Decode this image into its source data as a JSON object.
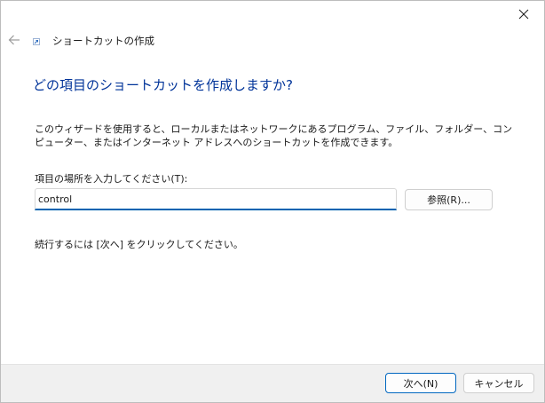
{
  "window": {
    "close_glyph": "✕"
  },
  "wizard": {
    "title": "ショートカットの作成",
    "heading": "どの項目のショートカットを作成しますか?",
    "description": "このウィザードを使用すると、ローカルまたはネットワークにあるプログラム、ファイル、フォルダー、コンピューター、またはインターネット アドレスへのショートカットを作成できます。",
    "field_label": "項目の場所を入力してください(T):",
    "location_value": "control",
    "browse_label": "参照(R)...",
    "instruction": "続行するには [次へ] をクリックしてください。"
  },
  "footer": {
    "next_label": "次へ(N)",
    "cancel_label": "キャンセル"
  },
  "icons": {
    "back": "back-arrow-icon",
    "close": "close-icon",
    "wizard": "shortcut-wizard-icon"
  },
  "colors": {
    "heading": "#003399",
    "accent": "#0063b1",
    "footer_bg": "#f0f0f0"
  }
}
